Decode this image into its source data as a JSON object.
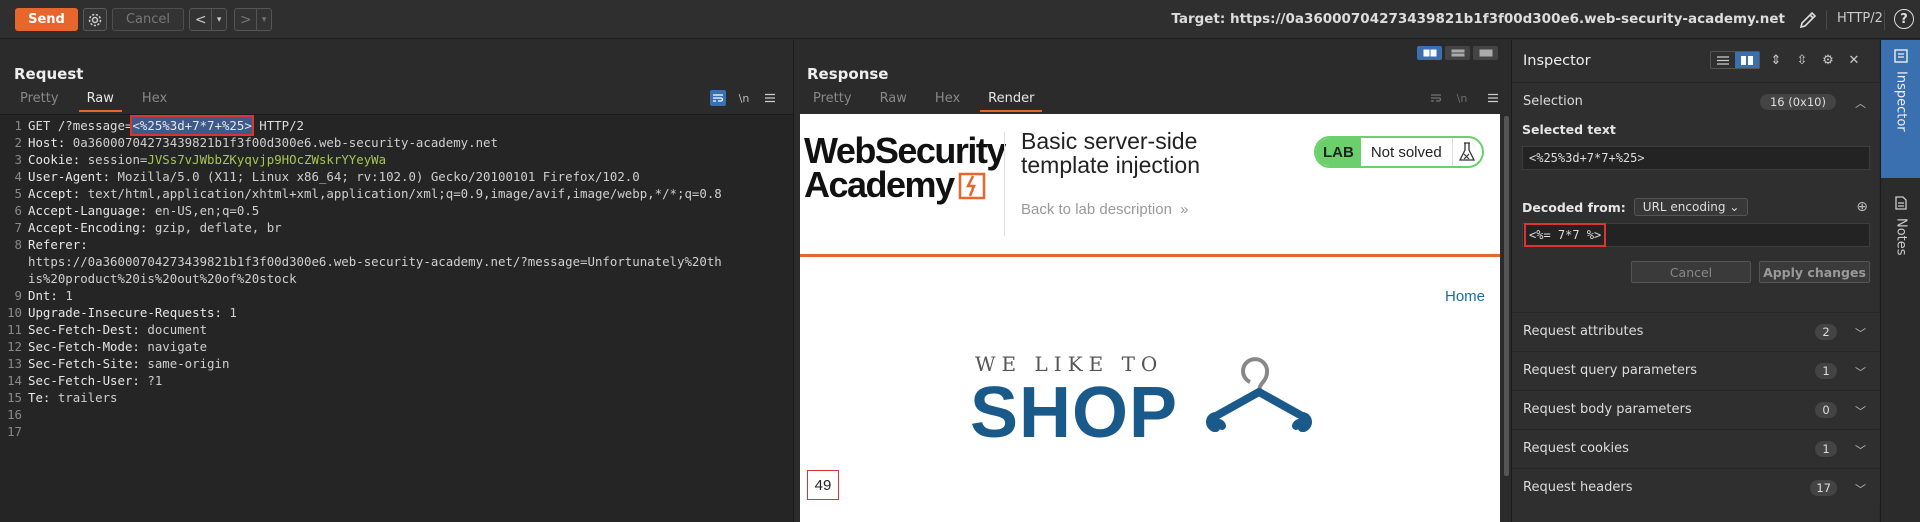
{
  "toolbar": {
    "send_label": "Send",
    "cancel_label": "Cancel",
    "target_label": "Target: https://0a36000704273439821b1f3f00d300e6.web-security-academy.net",
    "protocol": "HTTP/2",
    "help_glyph": "?"
  },
  "request": {
    "title": "Request",
    "tabs": [
      {
        "label": "Pretty"
      },
      {
        "label": "Raw"
      },
      {
        "label": "Hex"
      }
    ],
    "active_tab": "Raw",
    "newline_glyph": "\\n",
    "lines": [
      {
        "n": "1",
        "pre": "GET /?message=",
        "sel": "<%25%3d+7*7+%25>",
        "post": " HTTP/2"
      },
      {
        "n": "2",
        "key": "Host: ",
        "val": "0a36000704273439821b1f3f00d300e6.web-security-academy.net"
      },
      {
        "n": "3",
        "key": "Cookie: ",
        "val": "session=",
        "cookie": "JVSs7vJWbbZKyqvjp9HOcZWskrYYeyWa"
      },
      {
        "n": "4",
        "key": "User-Agent: ",
        "val": "Mozilla/5.0 (X11; Linux x86_64; rv:102.0) Gecko/20100101 Firefox/102.0"
      },
      {
        "n": "5",
        "key": "Accept: ",
        "val": "text/html,application/xhtml+xml,application/xml;q=0.9,image/avif,image/webp,*/*;q=0.8"
      },
      {
        "n": "6",
        "key": "Accept-Language: ",
        "val": "en-US,en;q=0.5"
      },
      {
        "n": "7",
        "key": "Accept-Encoding: ",
        "val": "gzip, deflate, br"
      },
      {
        "n": "8",
        "key": "Referer: ",
        "val": ""
      },
      {
        "n": "",
        "key": "",
        "val": "https://0a36000704273439821b1f3f00d300e6.web-security-academy.net/?message=Unfortunately%20th"
      },
      {
        "n": "",
        "key": "",
        "val": "is%20product%20is%20out%20of%20stock"
      },
      {
        "n": "9",
        "key": "Dnt: ",
        "val": "1"
      },
      {
        "n": "10",
        "key": "Upgrade-Insecure-Requests: ",
        "val": "1"
      },
      {
        "n": "11",
        "key": "Sec-Fetch-Dest: ",
        "val": "document"
      },
      {
        "n": "12",
        "key": "Sec-Fetch-Mode: ",
        "val": "navigate"
      },
      {
        "n": "13",
        "key": "Sec-Fetch-Site: ",
        "val": "same-origin"
      },
      {
        "n": "14",
        "key": "Sec-Fetch-User: ",
        "val": "?1"
      },
      {
        "n": "15",
        "key": "Te: ",
        "val": "trailers"
      },
      {
        "n": "16",
        "key": "",
        "val": ""
      },
      {
        "n": "17",
        "key": "",
        "val": ""
      }
    ]
  },
  "response": {
    "title": "Response",
    "tabs": [
      {
        "label": "Pretty"
      },
      {
        "label": "Raw"
      },
      {
        "label": "Hex"
      },
      {
        "label": "Render"
      }
    ],
    "active_tab": "Render",
    "newline_glyph": "\\n",
    "render": {
      "logo_line1": "WebSecurity",
      "logo_line2": "Academy",
      "lab_title_line1": "Basic server-side",
      "lab_title_line2": "template injection",
      "back_link": "Back to lab description",
      "back_chevrons": "»",
      "lab_badge": "LAB",
      "lab_status": "Not solved",
      "home_link": "Home",
      "shop_sub": "WE LIKE TO",
      "shop_main": "SHOP",
      "result": "49"
    }
  },
  "inspector": {
    "title": "Inspector",
    "selection_label": "Selection",
    "selection_count": "16 (0x10)",
    "selected_text_label": "Selected text",
    "selected_text": "<%25%3d+7*7+%25>",
    "decoded_from_label": "Decoded from:",
    "decoding": "URL encoding",
    "decoded_value": "<%= 7*7 %>",
    "cancel_label": "Cancel",
    "apply_label": "Apply changes",
    "sections": [
      {
        "label": "Request attributes",
        "count": "2"
      },
      {
        "label": "Request query parameters",
        "count": "1"
      },
      {
        "label": "Request body parameters",
        "count": "0"
      },
      {
        "label": "Request cookies",
        "count": "1"
      },
      {
        "label": "Request headers",
        "count": "17"
      }
    ]
  },
  "side_rail": {
    "inspector_tab": "Inspector",
    "notes_tab": "Notes"
  },
  "colors": {
    "accent": "#e8662b",
    "selection": "#3d5a8a",
    "active_blue": "#3a6fb0",
    "cookie_green": "#a7c64e",
    "lab_green": "#6bd06b",
    "shop_blue": "#1a5a8a"
  }
}
